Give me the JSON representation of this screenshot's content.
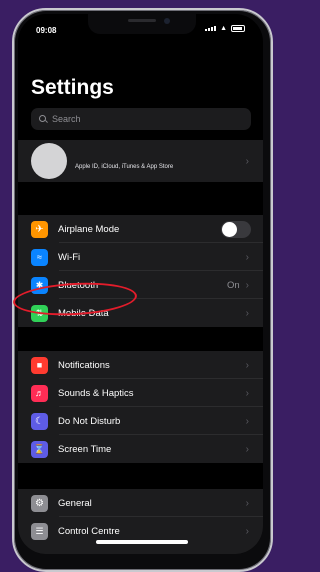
{
  "status": {
    "time": "09:08"
  },
  "header": {
    "title": "Settings"
  },
  "search": {
    "placeholder": "Search"
  },
  "profile": {
    "subtitle": "Apple ID, iCloud, iTunes & App Store"
  },
  "group1": [
    {
      "label": "Airplane Mode",
      "icon": "airplane-icon",
      "color": "#ff9500",
      "accessory": "toggle-off"
    },
    {
      "label": "Wi-Fi",
      "icon": "wifi-icon",
      "color": "#0a84ff",
      "accessory": "chevron"
    },
    {
      "label": "Bluetooth",
      "icon": "bluetooth-icon",
      "color": "#0a84ff",
      "value": "On",
      "accessory": "chevron"
    },
    {
      "label": "Mobile Data",
      "icon": "mobile-data-icon",
      "color": "#30d158",
      "accessory": "chevron"
    }
  ],
  "group2": [
    {
      "label": "Notifications",
      "icon": "notifications-icon",
      "color": "#ff3b30"
    },
    {
      "label": "Sounds & Haptics",
      "icon": "sound-icon",
      "color": "#ff2d55"
    },
    {
      "label": "Do Not Disturb",
      "icon": "moon-icon",
      "color": "#5e5ce6"
    },
    {
      "label": "Screen Time",
      "icon": "hourglass-icon",
      "color": "#5e5ce6"
    }
  ],
  "group3": [
    {
      "label": "General",
      "icon": "gear-icon",
      "color": "#8e8e93"
    },
    {
      "label": "Control Centre",
      "icon": "control-centre-icon",
      "color": "#8e8e93"
    }
  ],
  "colors": {
    "highlight": "#e31c2b",
    "background": "#3a1e63"
  }
}
